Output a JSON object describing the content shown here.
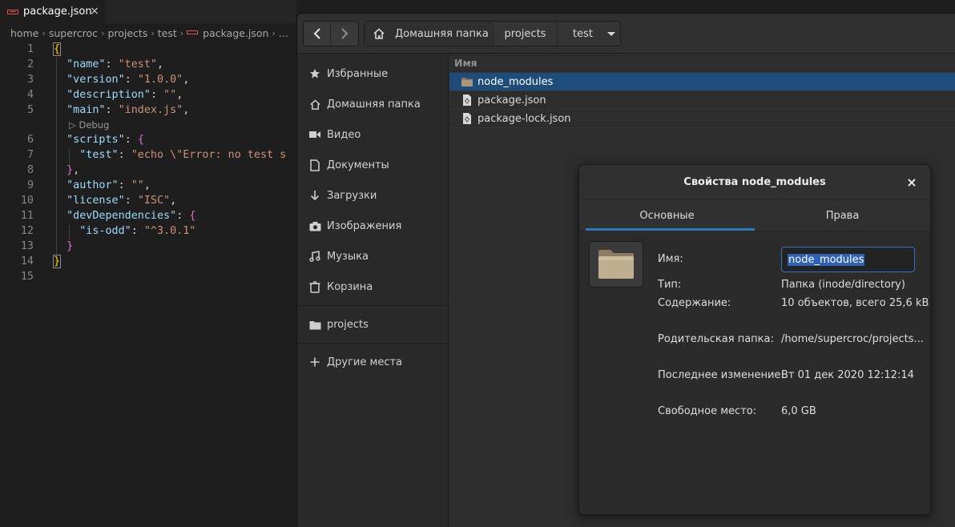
{
  "editor": {
    "tab": {
      "title": "package.json",
      "close": "×"
    },
    "breadcrumb": [
      "home",
      "supercroc",
      "projects",
      "test",
      "package.json",
      "..."
    ],
    "codelens": "▷ Debug",
    "line_numbers": [
      "1",
      "2",
      "3",
      "4",
      "5",
      "6",
      "7",
      "8",
      "9",
      "10",
      "11",
      "12",
      "13",
      "14",
      "15"
    ]
  },
  "file_manager": {
    "nav": {
      "back": "‹",
      "forward": "›"
    },
    "path": {
      "home": "Домашняя папка",
      "projects": "projects",
      "current": "test"
    },
    "sidebar": [
      {
        "label": "Избранные",
        "icon": "star-icon"
      },
      {
        "label": "Домашняя папка",
        "icon": "home-icon"
      },
      {
        "label": "Видео",
        "icon": "video-icon"
      },
      {
        "label": "Документы",
        "icon": "document-icon"
      },
      {
        "label": "Загрузки",
        "icon": "download-icon"
      },
      {
        "label": "Изображения",
        "icon": "camera-icon"
      },
      {
        "label": "Музыка",
        "icon": "music-icon"
      },
      {
        "label": "Корзина",
        "icon": "trash-icon"
      },
      {
        "label": "projects",
        "icon": "folder-icon"
      },
      {
        "label": "Другие места",
        "icon": "plus-icon"
      }
    ],
    "list": {
      "column": "Имя",
      "rows": [
        {
          "name": "node_modules",
          "icon": "folder-icon",
          "selected": true
        },
        {
          "name": "package.json",
          "icon": "file-icon",
          "selected": false
        },
        {
          "name": "package-lock.json",
          "icon": "file-icon",
          "selected": false
        }
      ]
    }
  },
  "dialog": {
    "title": "Свойства node_modules",
    "close": "×",
    "tabs": [
      "Основные",
      "Права"
    ],
    "name_label": "Имя:",
    "name_value": "node_modules",
    "props": [
      {
        "label": "Тип:",
        "value": "Папка (inode/directory)"
      },
      {
        "label": "Содержание:",
        "value": "10 объектов, всего 25,6 kB"
      },
      {
        "label": "Родительская папка:",
        "value": "/home/supercroc/projects..."
      },
      {
        "label": "Последнее изменение:",
        "value": "Вт 01 дек 2020 12:12:14"
      },
      {
        "label": "Свободное место:",
        "value": "6,0 GB"
      }
    ]
  },
  "colors": {
    "accent": "#2f76c5",
    "selection": "#1e4c7a",
    "json_key": "#9cdcfe",
    "json_string": "#ce9178"
  }
}
